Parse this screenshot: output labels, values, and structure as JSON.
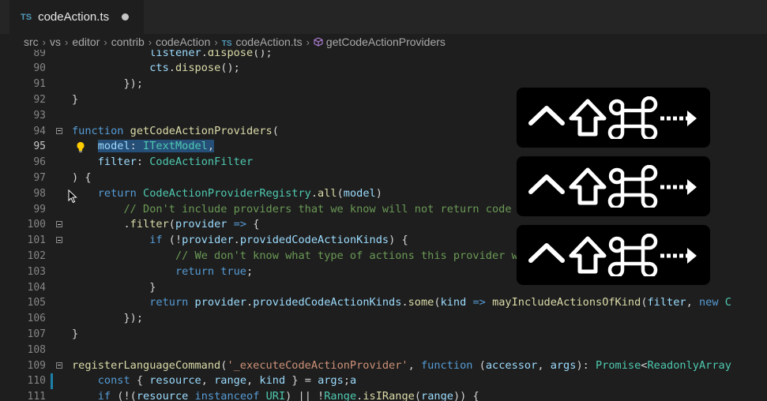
{
  "tab": {
    "badge": "TS",
    "title": "codeAction.ts"
  },
  "breadcrumb": {
    "items": [
      "src",
      "vs",
      "editor",
      "contrib",
      "codeAction"
    ],
    "file_badge": "TS",
    "file": "codeAction.ts",
    "symbol": "getCodeActionProviders"
  },
  "editor": {
    "lines": [
      {
        "n": "89",
        "html": "            <span class=\"pr\">listener</span>.<span class=\"fn\">dispose</span>();"
      },
      {
        "n": "90",
        "html": "            <span class=\"pr\">cts</span>.<span class=\"fn\">dispose</span>();"
      },
      {
        "n": "91",
        "html": "        });"
      },
      {
        "n": "92",
        "html": "}"
      },
      {
        "n": "93",
        "html": ""
      },
      {
        "n": "94",
        "html": "<span class=\"kw\">function</span> <span class=\"fn\">getCodeActionProviders</span>(",
        "fold": true
      },
      {
        "n": "95",
        "html": "    <span class=\"sel\"><span class=\"pr\">model</span>: <span class=\"ty\">ITextModel</span>,</span>",
        "active": true,
        "bulb": true
      },
      {
        "n": "96",
        "html": "    <span class=\"pr\">filter</span>: <span class=\"ty\">CodeActionFilter</span>"
      },
      {
        "n": "97",
        "html": ") {"
      },
      {
        "n": "98",
        "html": "    <span class=\"kw\">return</span> <span class=\"ty\">CodeActionProviderRegistry</span>.<span class=\"fn\">all</span>(<span class=\"pr\">model</span>)"
      },
      {
        "n": "99",
        "html": "        <span class=\"cm\">// Don't include providers that we know will not return code actions of interest</span>"
      },
      {
        "n": "100",
        "html": "        .<span class=\"fn\">filter</span>(<span class=\"pr\">provider</span> <span class=\"kw\">=&gt;</span> {",
        "fold": true
      },
      {
        "n": "101",
        "html": "            <span class=\"kw\">if</span> (!<span class=\"pr\">provider</span>.<span class=\"pr\">providedCodeActionKinds</span>) {",
        "fold": true
      },
      {
        "n": "102",
        "html": "                <span class=\"cm\">// We don't know what type of actions this provider will return</span>"
      },
      {
        "n": "103",
        "html": "                <span class=\"kw\">return</span> <span class=\"kw\">true</span>;"
      },
      {
        "n": "104",
        "html": "            }"
      },
      {
        "n": "105",
        "html": "            <span class=\"kw\">return</span> <span class=\"pr\">provider</span>.<span class=\"pr\">providedCodeActionKinds</span>.<span class=\"fn\">some</span>(<span class=\"pr\">kind</span> <span class=\"kw\">=&gt;</span> <span class=\"fn\">mayIncludeActionsOfKind</span>(<span class=\"pr\">filter</span>, <span class=\"kw\">new</span> <span class=\"ty\">C</span>"
      },
      {
        "n": "106",
        "html": "        });"
      },
      {
        "n": "107",
        "html": "}"
      },
      {
        "n": "108",
        "html": ""
      },
      {
        "n": "109",
        "html": "<span class=\"fn\">registerLanguageCommand</span>(<span class=\"st\">'_executeCodeActionProvider'</span>, <span class=\"kw\">function</span> (<span class=\"pr\">accessor</span>, <span class=\"pr\">args</span>): <span class=\"ty\">Promise</span>&lt;<span class=\"ty\">ReadonlyArray</span>",
        "fold": true
      },
      {
        "n": "110",
        "html": "    <span class=\"kw\">const</span> { <span class=\"pr\">resource</span>, <span class=\"pr\">range</span>, <span class=\"pr\">kind</span> } = <span class=\"pr\">args</span>;<span class=\"pr\">a</span>",
        "marker": true
      },
      {
        "n": "111",
        "html": "    <span class=\"kw\">if</span> (!(<span class=\"pr\">resource</span> <span class=\"kw\">instanceof</span> <span class=\"ty\">URI</span>) || !<span class=\"ty\">Range</span>.<span class=\"fn\">isIRange</span>(<span class=\"pr\">range</span>)) {"
      }
    ]
  },
  "shortcuts": [
    {
      "keys": "ctrl shift cmd right-arrow"
    },
    {
      "keys": "ctrl shift cmd right-arrow"
    },
    {
      "keys": "ctrl shift cmd right-arrow"
    }
  ]
}
